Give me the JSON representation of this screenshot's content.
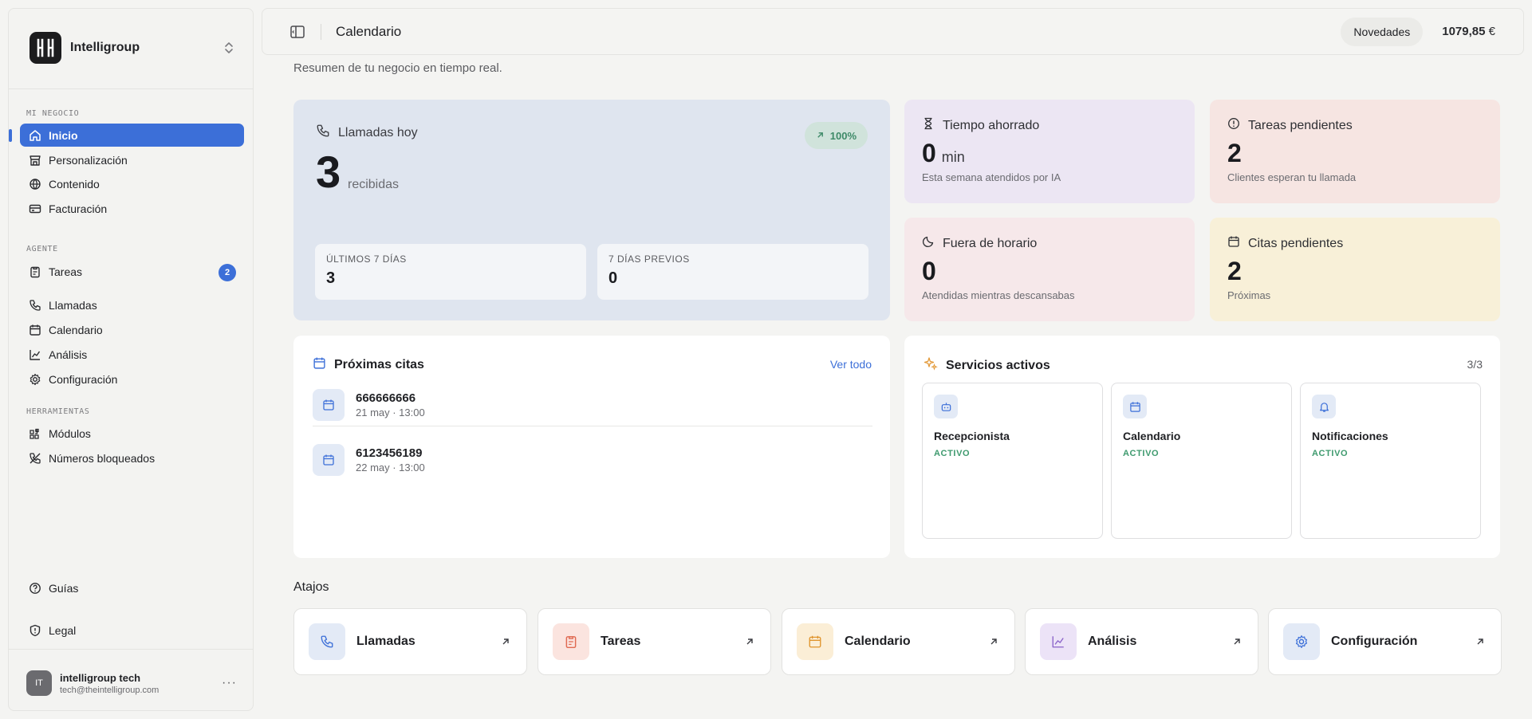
{
  "sidebar": {
    "brand": "Intelligroup",
    "sections": {
      "mi_negocio": "MI NEGOCIO",
      "agente": "AGENTE",
      "herramientas": "HERRAMIENTAS"
    },
    "items": {
      "inicio": "Inicio",
      "personalizacion": "Personalización",
      "contenido": "Contenido",
      "facturacion": "Facturación",
      "tareas": "Tareas",
      "tareas_badge": "2",
      "llamadas": "Llamadas",
      "calendario": "Calendario",
      "analisis": "Análisis",
      "configuracion": "Configuración",
      "modulos": "Módulos",
      "numeros_bloqueados": "Números bloqueados",
      "guias": "Guías",
      "legal": "Legal"
    },
    "user": {
      "initials": "IT",
      "name": "intelligroup tech",
      "email": "tech@theintelligroup.com"
    }
  },
  "header": {
    "title": "Calendario",
    "novedades": "Novedades",
    "balance": "1079,85",
    "currency": "€"
  },
  "subtitle": "Resumen de tu negocio en tiempo real.",
  "calls": {
    "title": "Llamadas hoy",
    "trend": "100%",
    "value": "3",
    "unit": "recibidas",
    "last7_label": "ÚLTIMOS 7 DÍAS",
    "last7_value": "3",
    "prev7_label": "7 DÍAS PREVIOS",
    "prev7_value": "0"
  },
  "stats": {
    "tiempo": {
      "title": "Tiempo ahorrado",
      "value": "0",
      "unit": "min",
      "sub": "Esta semana atendidos por IA"
    },
    "tareas": {
      "title": "Tareas pendientes",
      "value": "2",
      "sub": "Clientes esperan tu llamada"
    },
    "fuera": {
      "title": "Fuera de horario",
      "value": "0",
      "sub": "Atendidas mientras descansabas"
    },
    "citas": {
      "title": "Citas pendientes",
      "value": "2",
      "sub": "Próximas"
    }
  },
  "proximas": {
    "title": "Próximas citas",
    "link": "Ver todo",
    "items": [
      {
        "name": "666666666",
        "time": "21 may · 13:00"
      },
      {
        "name": "6123456189",
        "time": "22 may · 13:00"
      }
    ]
  },
  "servicios": {
    "title": "Servicios activos",
    "count": "3/3",
    "items": [
      {
        "name": "Recepcionista",
        "status": "ACTIVO"
      },
      {
        "name": "Calendario",
        "status": "ACTIVO"
      },
      {
        "name": "Notificaciones",
        "status": "ACTIVO"
      }
    ]
  },
  "atajos": {
    "title": "Atajos",
    "items": [
      {
        "label": "Llamadas"
      },
      {
        "label": "Tareas"
      },
      {
        "label": "Calendario"
      },
      {
        "label": "Análisis"
      },
      {
        "label": "Configuración"
      }
    ]
  },
  "colors": {
    "accent": "#3c6fd8",
    "calls_card": "#dfe5ef",
    "tiempo_card": "#ece6f3",
    "tareas_card": "#f6e5e2",
    "fuera_card": "#f6e8ea",
    "citas_card": "#f8f0d8",
    "active_green": "#3e9a6e"
  }
}
